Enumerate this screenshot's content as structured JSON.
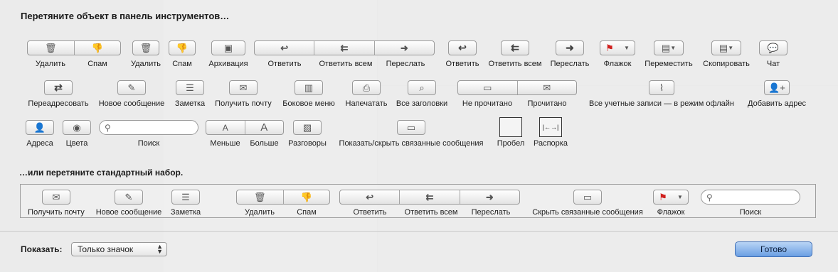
{
  "sheet": {
    "drag_items_title": "Перетяните объект в панель инструментов…",
    "default_set_title": "…или перетяните стандартный набор."
  },
  "items_row1": [
    {
      "label": "Удалить",
      "icon": "trash-icon"
    },
    {
      "label": "Спам",
      "icon": "thumbs-down-icon"
    },
    {
      "label": "Удалить",
      "icon": "trash-icon"
    },
    {
      "label": "Спам",
      "icon": "thumbs-down-icon"
    },
    {
      "label": "Архивация",
      "icon": "archive-box-icon"
    },
    {
      "label": "Ответить",
      "icon": "reply-arrow-icon"
    },
    {
      "label": "Ответить всем",
      "icon": "reply-all-arrow-icon"
    },
    {
      "label": "Переслать",
      "icon": "forward-arrow-icon"
    },
    {
      "label": "Ответить",
      "icon": "reply-arrow-icon"
    },
    {
      "label": "Ответить всем",
      "icon": "reply-all-arrow-icon"
    },
    {
      "label": "Переслать",
      "icon": "forward-arrow-icon"
    },
    {
      "label": "Флажок",
      "icon": "flag-icon"
    },
    {
      "label": "Переместить",
      "icon": "folder-move-icon"
    },
    {
      "label": "Скопировать",
      "icon": "folder-copy-icon"
    },
    {
      "label": "Чат",
      "icon": "chat-bubble-icon"
    }
  ],
  "items_row2": [
    {
      "label": "Переадресовать",
      "icon": "redirect-arrow-icon"
    },
    {
      "label": "Новое сообщение",
      "icon": "compose-icon"
    },
    {
      "label": "Заметка",
      "icon": "note-icon"
    },
    {
      "label": "Получить почту",
      "icon": "envelope-icon"
    },
    {
      "label": "Боковое меню",
      "icon": "sidebar-icon"
    },
    {
      "label": "Напечатать",
      "icon": "printer-icon"
    },
    {
      "label": "Все заголовки",
      "icon": "headers-icon"
    },
    {
      "label": "Не прочитано",
      "icon": "envelope-open-icon"
    },
    {
      "label": "Прочитано",
      "icon": "envelope-icon"
    },
    {
      "label": "Все учетные записи — в режим офлайн",
      "icon": "offline-icon"
    },
    {
      "label": "Добавить адрес",
      "icon": "add-contact-icon"
    }
  ],
  "items_row3": [
    {
      "label": "Адреса",
      "icon": "contacts-icon"
    },
    {
      "label": "Цвета",
      "icon": "color-wheel-icon"
    },
    {
      "label": "Поиск",
      "icon": "search-icon"
    },
    {
      "label": "Меньше",
      "icon": "font-smaller-icon"
    },
    {
      "label": "Больше",
      "icon": "font-bigger-icon"
    },
    {
      "label": "Разговоры",
      "icon": "conversations-icon"
    },
    {
      "label": "Показать/скрыть связанные сообщения",
      "icon": "related-messages-icon"
    },
    {
      "label": "Пробел",
      "icon": "space-box"
    },
    {
      "label": "Распорка",
      "icon": "flexible-space-box"
    }
  ],
  "default_set": [
    {
      "label": "Получить почту",
      "icon": "envelope-icon"
    },
    {
      "label": "Новое сообщение",
      "icon": "compose-icon"
    },
    {
      "label": "Заметка",
      "icon": "note-icon"
    },
    {
      "label": "Удалить",
      "icon": "trash-icon"
    },
    {
      "label": "Спам",
      "icon": "thumbs-down-icon"
    },
    {
      "label": "Ответить",
      "icon": "reply-arrow-icon"
    },
    {
      "label": "Ответить всем",
      "icon": "reply-all-arrow-icon"
    },
    {
      "label": "Переслать",
      "icon": "forward-arrow-icon"
    },
    {
      "label": "Скрыть связанные сообщения",
      "icon": "related-messages-icon"
    },
    {
      "label": "Флажок",
      "icon": "flag-icon"
    },
    {
      "label": "Поиск",
      "icon": "search-icon"
    }
  ],
  "footer": {
    "show_label": "Показать:",
    "show_value": "Только значок",
    "done_label": "Готово"
  },
  "colors": {
    "done_button": "#6a9fe3",
    "flag": "#d0201e"
  }
}
